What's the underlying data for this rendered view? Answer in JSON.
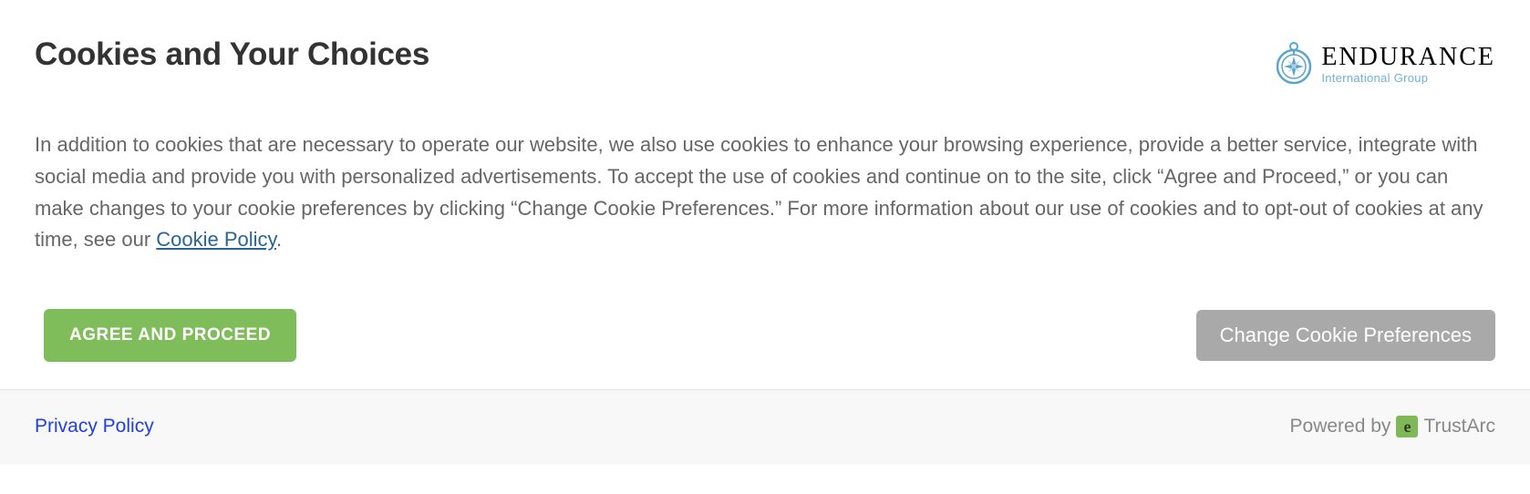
{
  "header": {
    "title": "Cookies and Your Choices",
    "brand": {
      "name_main": "ENDURANCE",
      "name_sub": "International Group"
    }
  },
  "body": {
    "desc_part1": "In addition to cookies that are necessary to operate our website, we also use cookies to enhance your browsing experience, provide a better service, integrate with social media and provide you with personalized advertisements. To accept the use of cookies and continue on to the site, click “Agree and Proceed,” or you can make changes to your cookie preferences by clicking “Change Cookie Preferences.” For more information about our use of cookies and to opt-out of cookies at any time, see our ",
    "cookie_policy_link": "Cookie Policy",
    "desc_part2": "."
  },
  "buttons": {
    "agree_label": "AGREE AND PROCEED",
    "change_label": "Change Cookie Preferences"
  },
  "footer": {
    "privacy_label": "Privacy Policy",
    "powered_by_prefix": "Powered by",
    "powered_by_name": "TrustArc"
  }
}
